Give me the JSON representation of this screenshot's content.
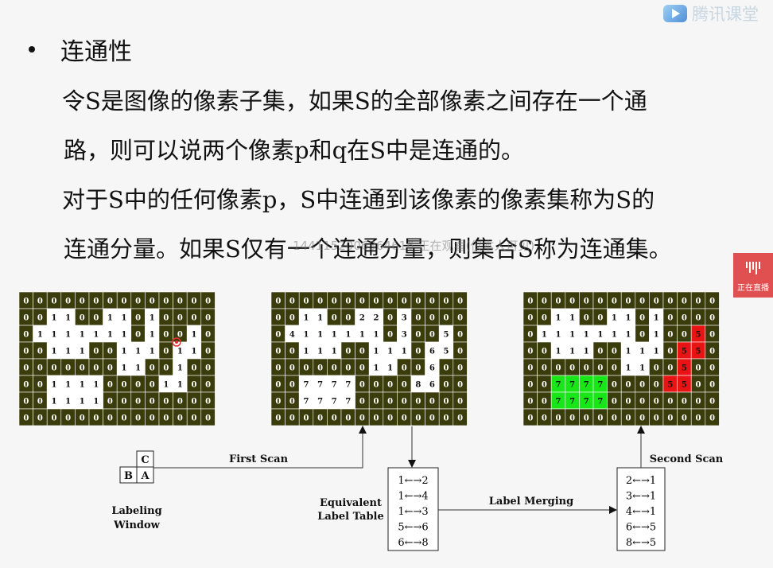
{
  "logo": {
    "text": "腾讯课堂"
  },
  "bullet": {
    "heading": "连通性"
  },
  "paragraphs": [
    {
      "line1": "令S是图像的像素子集，如果S的全部像素之间存在一个通",
      "line2": "路，则可以说两个像素p和q在S中是连通的。"
    },
    {
      "line1": "对于S中的任何像素p，S中连通到该像素的像素集称为S的",
      "line2": "连通分量。如果S仅有一个连通分量，则集合S称为连通集。"
    }
  ],
  "watermark": "1441152006364616 正在观看(仅本人可见)",
  "live_badge": {
    "text": "正在直播"
  },
  "colors": {
    "grid_bg": "#3b3c0c",
    "grid_line": "#ffffff",
    "white_cell": "#ffffff",
    "green": "#19e619",
    "red": "#e81414",
    "slide_bg": "#f6f6f6"
  },
  "grids": [
    {
      "name": "input-grid",
      "rows": [
        [
          "0",
          "0",
          "0",
          "0",
          "0",
          "0",
          "0",
          "0",
          "0",
          "0",
          "0",
          "0",
          "0",
          "0"
        ],
        [
          "0",
          "0",
          "1",
          "1",
          "0",
          "0",
          "1",
          "1",
          "0",
          "1",
          "0",
          "0",
          "0",
          "0"
        ],
        [
          "0",
          "1",
          "1",
          "1",
          "1",
          "1",
          "1",
          "1",
          "0",
          "1",
          "0",
          "0",
          "1",
          "0"
        ],
        [
          "0",
          "0",
          "1",
          "1",
          "1",
          "0",
          "0",
          "1",
          "1",
          "1",
          "0",
          "1",
          "1",
          "0"
        ],
        [
          "0",
          "0",
          "0",
          "0",
          "0",
          "0",
          "0",
          "1",
          "1",
          "0",
          "0",
          "1",
          "0",
          "0"
        ],
        [
          "0",
          "0",
          "1",
          "1",
          "1",
          "1",
          "0",
          "0",
          "0",
          "0",
          "1",
          "1",
          "0",
          "0"
        ],
        [
          "0",
          "0",
          "1",
          "1",
          "1",
          "1",
          "0",
          "0",
          "0",
          "0",
          "0",
          "0",
          "0",
          "0"
        ],
        [
          "0",
          "0",
          "0",
          "0",
          "0",
          "0",
          "0",
          "0",
          "0",
          "0",
          "0",
          "0",
          "0",
          "0"
        ]
      ],
      "fills": [
        "..............",
        "..WW..WW.W....",
        ".WWWWWWW.W..W.",
        "..WWW..WWW.WW.",
        ".......WW..W..",
        "..WWWW....WW..",
        "..WWWW........",
        ".............."
      ]
    },
    {
      "name": "first-scan-grid",
      "rows": [
        [
          "0",
          "0",
          "0",
          "0",
          "0",
          "0",
          "0",
          "0",
          "0",
          "0",
          "0",
          "0",
          "0",
          "0"
        ],
        [
          "0",
          "0",
          "1",
          "1",
          "0",
          "0",
          "2",
          "2",
          "0",
          "3",
          "0",
          "0",
          "0",
          "0"
        ],
        [
          "0",
          "4",
          "1",
          "1",
          "1",
          "1",
          "1",
          "1",
          "0",
          "3",
          "0",
          "0",
          "5",
          "0"
        ],
        [
          "0",
          "0",
          "1",
          "1",
          "1",
          "0",
          "0",
          "1",
          "1",
          "1",
          "0",
          "6",
          "5",
          "0"
        ],
        [
          "0",
          "0",
          "0",
          "0",
          "0",
          "0",
          "0",
          "1",
          "1",
          "0",
          "0",
          "6",
          "0",
          "0"
        ],
        [
          "0",
          "0",
          "7",
          "7",
          "7",
          "7",
          "0",
          "0",
          "0",
          "0",
          "8",
          "6",
          "0",
          "0"
        ],
        [
          "0",
          "0",
          "7",
          "7",
          "7",
          "7",
          "0",
          "0",
          "0",
          "0",
          "0",
          "0",
          "0",
          "0"
        ],
        [
          "0",
          "0",
          "0",
          "0",
          "0",
          "0",
          "0",
          "0",
          "0",
          "0",
          "0",
          "0",
          "0",
          "0"
        ]
      ],
      "fills": [
        "..............",
        "..WW..WW.W....",
        ".WWWWWWW.W..W.",
        "..WWW..WWW.WW.",
        ".......WW..W..",
        "..WWWW....WW..",
        "..WWWW........",
        ".............."
      ]
    },
    {
      "name": "second-scan-grid",
      "rows": [
        [
          "0",
          "0",
          "0",
          "0",
          "0",
          "0",
          "0",
          "0",
          "0",
          "0",
          "0",
          "0",
          "0",
          "0"
        ],
        [
          "0",
          "0",
          "1",
          "1",
          "0",
          "0",
          "1",
          "1",
          "0",
          "1",
          "0",
          "0",
          "0",
          "0"
        ],
        [
          "0",
          "1",
          "1",
          "1",
          "1",
          "1",
          "1",
          "1",
          "0",
          "1",
          "0",
          "0",
          "5",
          "0"
        ],
        [
          "0",
          "0",
          "1",
          "1",
          "1",
          "0",
          "0",
          "1",
          "1",
          "1",
          "0",
          "5",
          "5",
          "0"
        ],
        [
          "0",
          "0",
          "0",
          "0",
          "0",
          "0",
          "0",
          "1",
          "1",
          "0",
          "0",
          "5",
          "0",
          "0"
        ],
        [
          "0",
          "0",
          "7",
          "7",
          "7",
          "7",
          "0",
          "0",
          "0",
          "0",
          "5",
          "5",
          "0",
          "0"
        ],
        [
          "0",
          "0",
          "7",
          "7",
          "7",
          "7",
          "0",
          "0",
          "0",
          "0",
          "0",
          "0",
          "0",
          "0"
        ],
        [
          "0",
          "0",
          "0",
          "0",
          "0",
          "0",
          "0",
          "0",
          "0",
          "0",
          "0",
          "0",
          "0",
          "0"
        ]
      ],
      "fills": [
        "..............",
        "..WW..WW.W....",
        ".WWWWWWW.W..R.",
        "..WWW..WWW.RR.",
        ".......WW..R..",
        "..GGGG....RR..",
        "..GGGG........",
        ".............."
      ]
    }
  ],
  "labeling_window": {
    "cells": {
      "c": "C",
      "b": "B",
      "a": "A"
    },
    "caption_line1": "Labeling",
    "caption_line2": "Window"
  },
  "first_scan": {
    "label": "First Scan"
  },
  "second_scan": {
    "label": "Second Scan"
  },
  "equivalent_table": {
    "caption_line1": "Equivalent",
    "caption_line2": "Label Table",
    "entries": [
      "1←→2",
      "1←→4",
      "1←→3",
      "5←→6",
      "6←→8"
    ]
  },
  "label_merging": {
    "label": "Label Merging"
  },
  "merged_table": {
    "entries": [
      "2←→1",
      "3←→1",
      "4←→1",
      "6←→5",
      "8←→5"
    ]
  }
}
